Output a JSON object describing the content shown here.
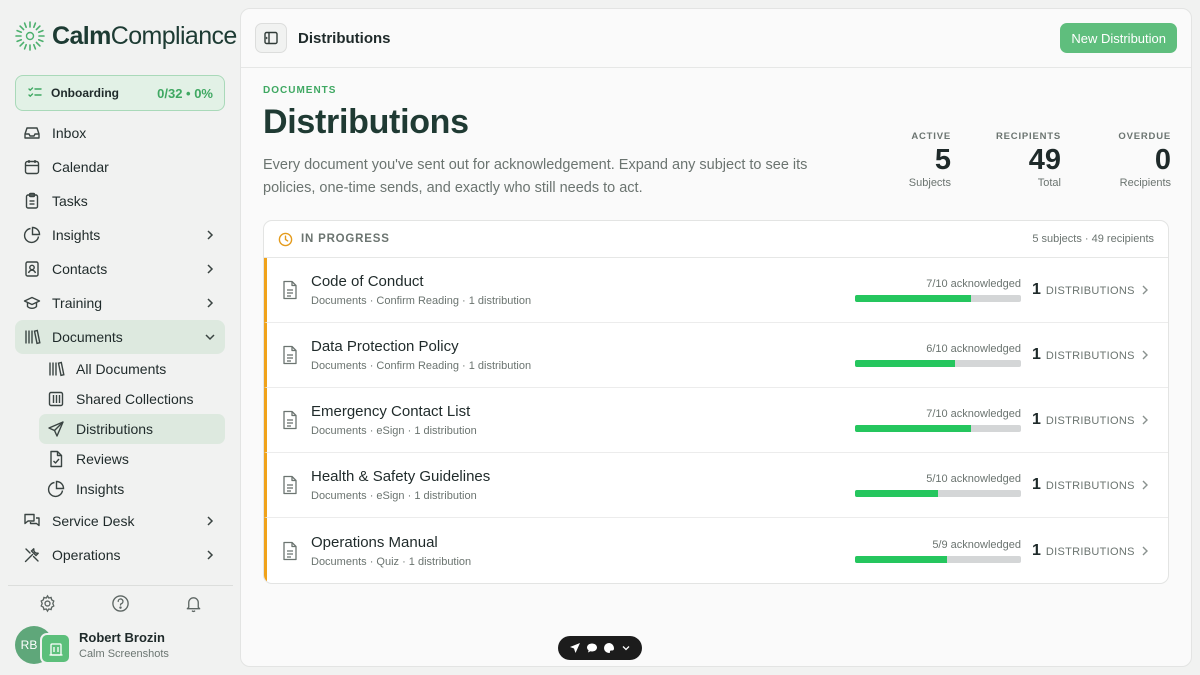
{
  "app": {
    "logo_part1": "Calm",
    "logo_part2": "Compliance"
  },
  "onboarding": {
    "label": "Onboarding",
    "progress": "0/32 • 0%"
  },
  "sidebar": {
    "items": [
      {
        "label": "Inbox",
        "icon": "inbox-icon"
      },
      {
        "label": "Calendar",
        "icon": "calendar-icon"
      },
      {
        "label": "Tasks",
        "icon": "clipboard-icon"
      },
      {
        "label": "Insights",
        "icon": "pie-chart-icon"
      },
      {
        "label": "Contacts",
        "icon": "contact-card-icon"
      },
      {
        "label": "Training",
        "icon": "graduation-cap-icon"
      },
      {
        "label": "Documents",
        "icon": "library-icon"
      },
      {
        "label": "Service Desk",
        "icon": "chat-bubbles-icon"
      },
      {
        "label": "Operations",
        "icon": "tools-icon"
      }
    ],
    "documents_sub": [
      {
        "label": "All Documents",
        "icon": "library-icon"
      },
      {
        "label": "Shared Collections",
        "icon": "collection-icon"
      },
      {
        "label": "Distributions",
        "icon": "send-icon"
      },
      {
        "label": "Reviews",
        "icon": "file-check-icon"
      },
      {
        "label": "Insights",
        "icon": "pie-chart-icon"
      }
    ]
  },
  "user": {
    "initials": "RB",
    "name": "Robert Brozin",
    "org": "Calm Screenshots"
  },
  "topbar": {
    "title": "Distributions",
    "new_button": "New Distribution"
  },
  "page": {
    "eyebrow": "DOCUMENTS",
    "title": "Distributions",
    "description": "Every document you've sent out for acknowledgement. Expand any subject to see its policies, one-time sends, and exactly who still needs to act."
  },
  "stats": [
    {
      "label": "ACTIVE",
      "value": "5",
      "sub": "Subjects"
    },
    {
      "label": "RECIPIENTS",
      "value": "49",
      "sub": "Total"
    },
    {
      "label": "OVERDUE",
      "value": "0",
      "sub": "Recipients"
    }
  ],
  "panel": {
    "label": "IN PROGRESS",
    "meta": "5 subjects · 49 recipients"
  },
  "distributions": [
    {
      "title": "Code of Conduct",
      "meta": "Documents · Confirm Reading · 1 distribution",
      "ack": "7/10 acknowledged",
      "fraction": 0.7,
      "count": "1",
      "count_label": "DISTRIBUTIONS"
    },
    {
      "title": "Data Protection Policy",
      "meta": "Documents · Confirm Reading · 1 distribution",
      "ack": "6/10 acknowledged",
      "fraction": 0.6,
      "count": "1",
      "count_label": "DISTRIBUTIONS"
    },
    {
      "title": "Emergency Contact List",
      "meta": "Documents · eSign · 1 distribution",
      "ack": "7/10 acknowledged",
      "fraction": 0.7,
      "count": "1",
      "count_label": "DISTRIBUTIONS"
    },
    {
      "title": "Health & Safety Guidelines",
      "meta": "Documents · eSign · 1 distribution",
      "ack": "5/10 acknowledged",
      "fraction": 0.5,
      "count": "1",
      "count_label": "DISTRIBUTIONS"
    },
    {
      "title": "Operations Manual",
      "meta": "Documents · Quiz · 1 distribution",
      "ack": "5/9 acknowledged",
      "fraction": 0.556,
      "count": "1",
      "count_label": "DISTRIBUTIONS"
    }
  ],
  "colors": {
    "accent": "#5fbe7d",
    "progress_fill": "#25c65e",
    "in_progress_border": "#f0a21a",
    "active_nav": "#dde9df"
  }
}
